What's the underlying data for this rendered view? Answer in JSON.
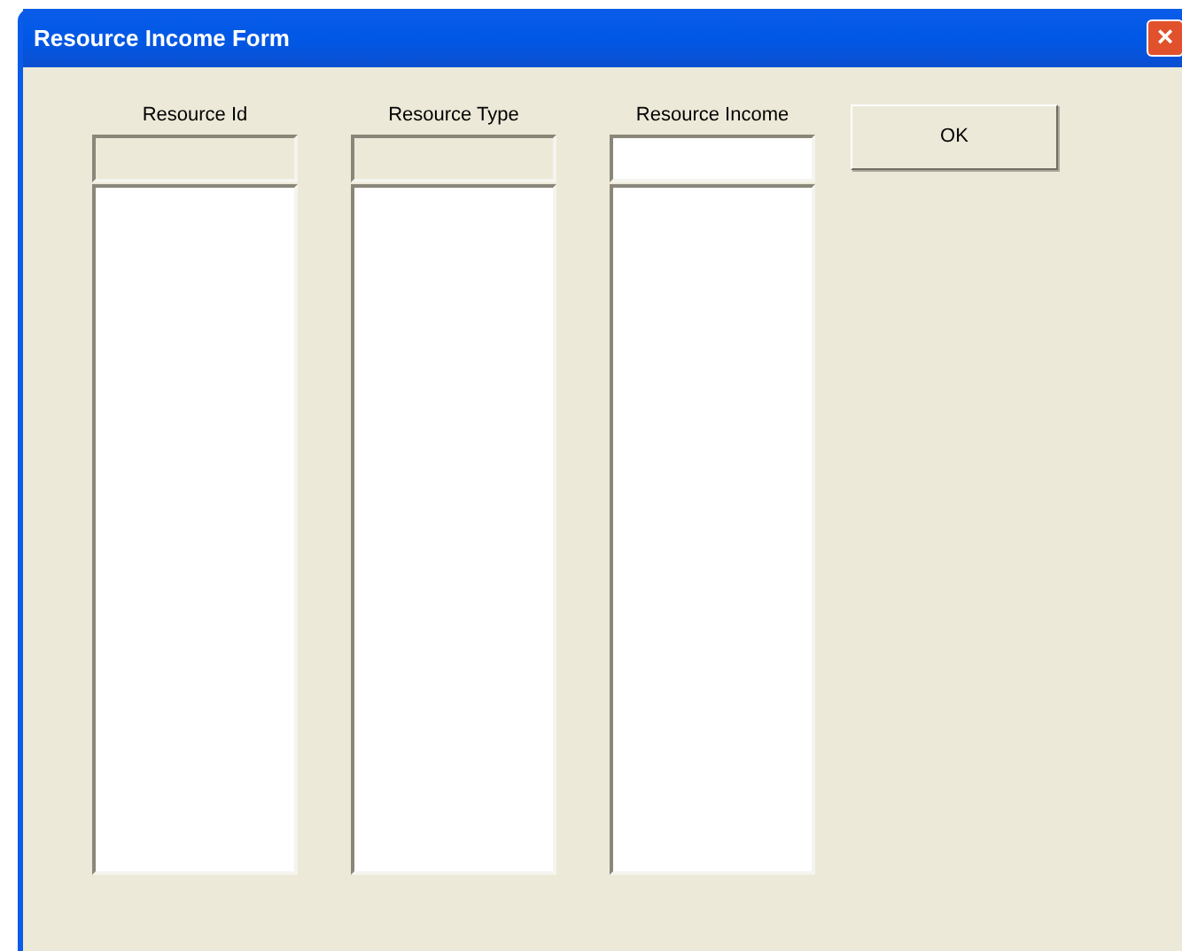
{
  "window": {
    "title": "Resource Income Form",
    "close": "×"
  },
  "columns": [
    {
      "label": "Resource Id",
      "field_disabled": true
    },
    {
      "label": "Resource Type",
      "field_disabled": true
    },
    {
      "label": "Resource Income",
      "field_disabled": false
    }
  ],
  "ok_button": "OK"
}
